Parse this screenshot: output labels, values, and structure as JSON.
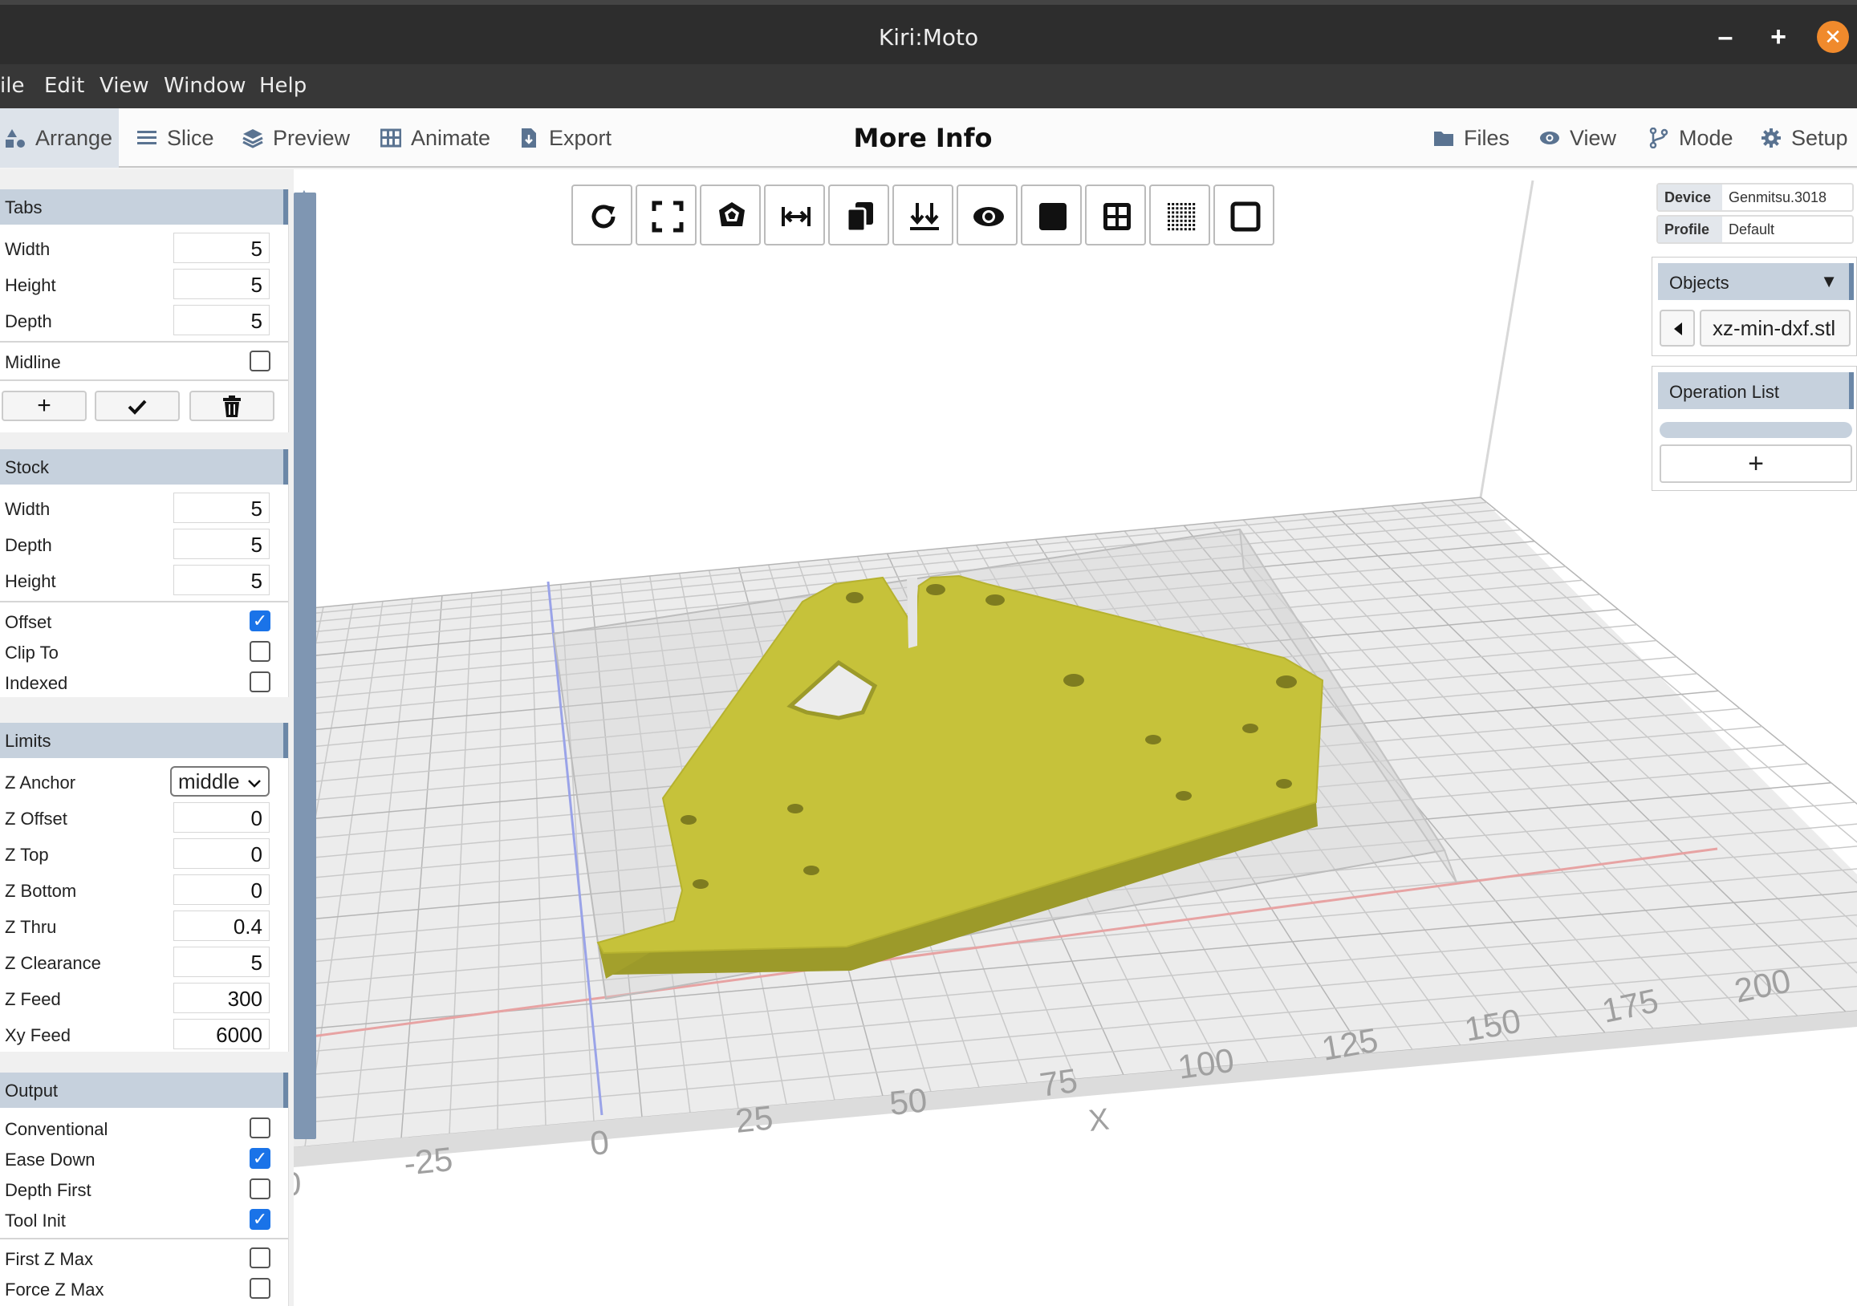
{
  "window": {
    "title": "Kiri:Moto",
    "min": "–",
    "max": "+",
    "close": "✕"
  },
  "menu": [
    "ile",
    "Edit",
    "View",
    "Window",
    "Help"
  ],
  "toolbar": {
    "left": [
      "Arrange",
      "Slice",
      "Preview",
      "Animate",
      "Export"
    ],
    "center": "More Info",
    "right": [
      "Files",
      "View",
      "Mode",
      "Setup"
    ]
  },
  "view_tools": [
    "reload-icon",
    "fullscreen-icon",
    "shape-icon",
    "fit-width-icon",
    "duplicate-icon",
    "drop-icon",
    "eye-icon",
    "solid-square-icon",
    "grid-icon",
    "dots-grid-icon",
    "empty-square-icon"
  ],
  "tabs": {
    "header": "Tabs",
    "width_label": "Width",
    "width": "5",
    "height_label": "Height",
    "height": "5",
    "depth_label": "Depth",
    "depth": "5",
    "midline_label": "Midline",
    "midline": false,
    "buttons": [
      "+",
      "✓",
      "🗑"
    ]
  },
  "stock": {
    "header": "Stock",
    "width_label": "Width",
    "width": "5",
    "depth_label": "Depth",
    "depth": "5",
    "height_label": "Height",
    "height": "5",
    "offset_label": "Offset",
    "offset": true,
    "clipto_label": "Clip To",
    "clipto": false,
    "indexed_label": "Indexed",
    "indexed": false
  },
  "limits": {
    "header": "Limits",
    "zanchor_label": "Z Anchor",
    "zanchor": "middle",
    "zoffset_label": "Z Offset",
    "zoffset": "0",
    "ztop_label": "Z Top",
    "ztop": "0",
    "zbottom_label": "Z Bottom",
    "zbottom": "0",
    "zthru_label": "Z Thru",
    "zthru": "0.4",
    "zclear_label": "Z Clearance",
    "zclear": "5",
    "zfeed_label": "Z Feed",
    "zfeed": "300",
    "xyfeed_label": "Xy Feed",
    "xyfeed": "6000"
  },
  "output": {
    "header": "Output",
    "conventional_label": "Conventional",
    "conventional": false,
    "easedown_label": "Ease Down",
    "easedown": true,
    "depthfirst_label": "Depth First",
    "depthfirst": false,
    "toolinit_label": "Tool Init",
    "toolinit": true,
    "firstzmax_label": "First Z Max",
    "firstzmax": false,
    "forcezmax_label": "Force Z Max",
    "forcezmax": false
  },
  "right": {
    "device_label": "Device",
    "device": "Genmitsu.3018",
    "profile_label": "Profile",
    "profile": "Default",
    "objects_label": "Objects",
    "objects_arrow": "▼",
    "object_name": "xz-min-dxf.stl",
    "oplist_label": "Operation List",
    "add_label": "+"
  },
  "axis": {
    "x_ticks": [
      "-25",
      "0",
      "25",
      "50",
      "75",
      "100",
      "125",
      "150",
      "175",
      "200"
    ],
    "x_label": "X",
    "left_partial": "0"
  },
  "colors": {
    "part": "#c6c23a",
    "part_dark": "#9c9a2a",
    "accent": "#6b87a7",
    "close": "#f08a2c"
  }
}
